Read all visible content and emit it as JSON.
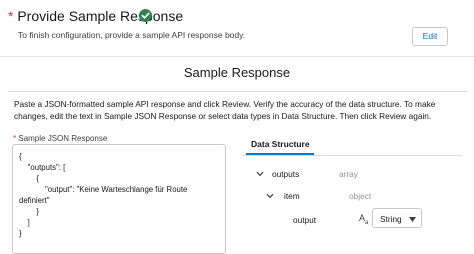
{
  "header": {
    "title": "Provide Sample Response",
    "description": "To finish configuration, provide a sample API response body.",
    "edit_label": "Edit"
  },
  "section": {
    "heading": "Sample Response",
    "instructions": "Paste a JSON-formatted sample API response and click Review. Verify the accuracy of the data structure. To make changes, edit the text in Sample JSON Response or select data types in Data Structure. Then click Review again."
  },
  "json_field": {
    "required_marker": "*",
    "label": "Sample JSON Response",
    "value": "{\n    \"outputs\": [\n        {\n            \"output\": \"Keine Warteschlange für Route\ndefiniert\"\n        }\n    ]\n}"
  },
  "data_structure": {
    "tab_label": "Data Structure",
    "rows": [
      {
        "name": "outputs",
        "type": "array"
      },
      {
        "name": "item",
        "type": "object"
      },
      {
        "name": "output",
        "type_select": "String"
      }
    ],
    "text_type_icon": "text-type-icon"
  },
  "colors": {
    "success": "#2e844a",
    "brand": "#0176d3",
    "required": "#c23934"
  }
}
